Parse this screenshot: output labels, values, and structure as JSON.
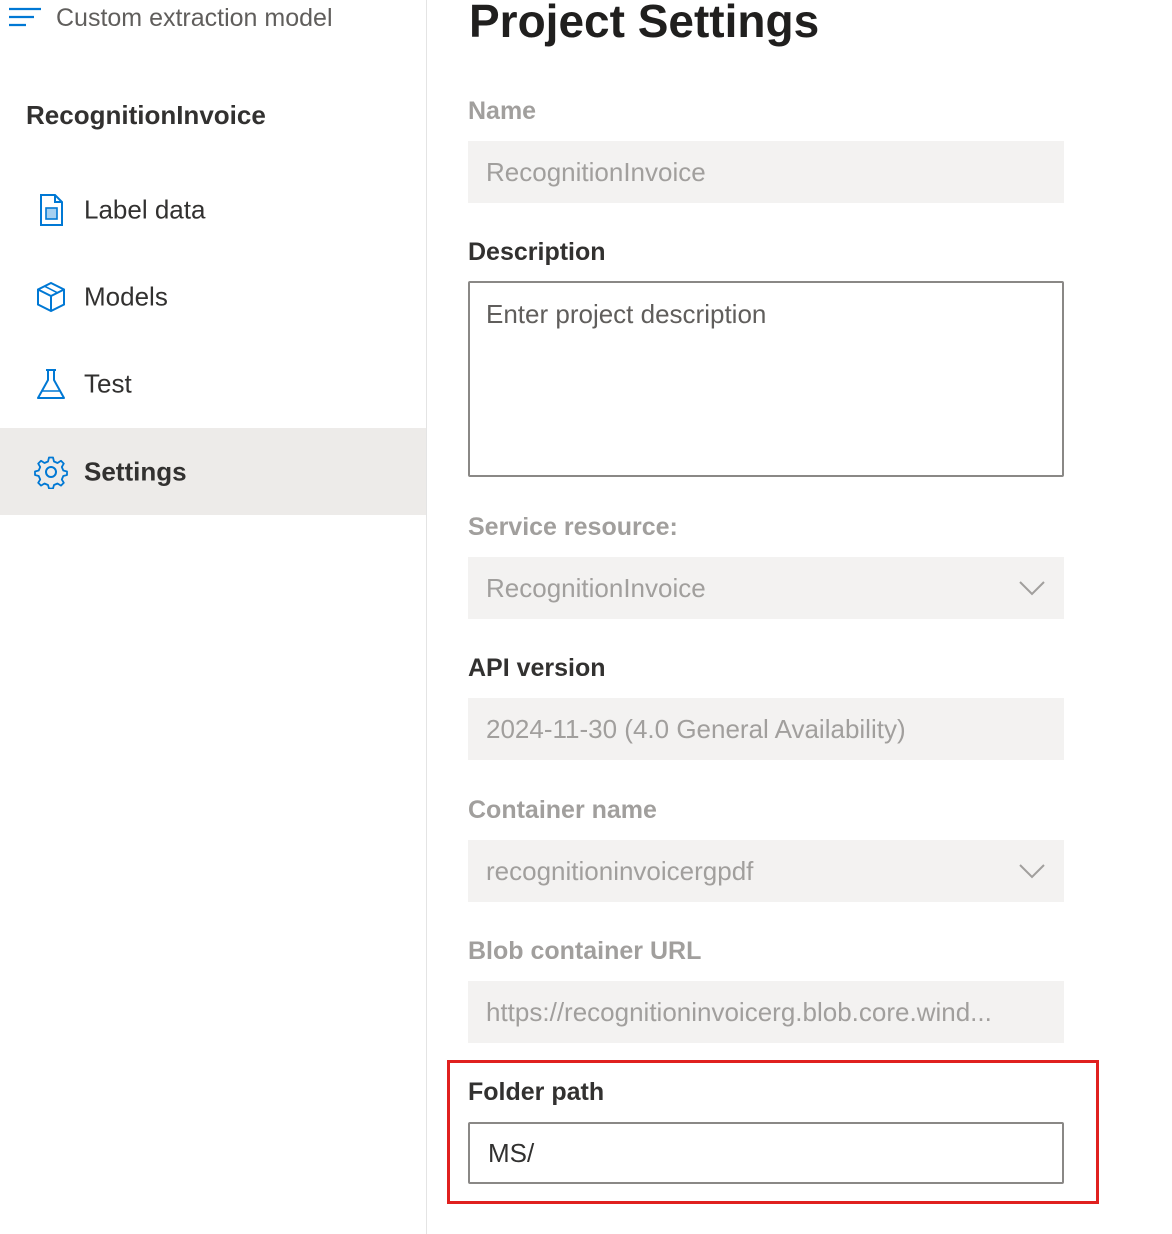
{
  "sidebar": {
    "app_title": "Custom extraction model",
    "project_name": "RecognitionInvoice",
    "items": [
      {
        "label": "Label data",
        "icon": "document-icon"
      },
      {
        "label": "Models",
        "icon": "cube-icon"
      },
      {
        "label": "Test",
        "icon": "flask-icon"
      },
      {
        "label": "Settings",
        "icon": "gear-icon",
        "selected": true
      }
    ]
  },
  "main": {
    "title": "Project Settings",
    "fields": {
      "name": {
        "label": "Name",
        "value": "RecognitionInvoice"
      },
      "description": {
        "label": "Description",
        "placeholder": "Enter project description"
      },
      "service_resource": {
        "label": "Service resource:",
        "value": "RecognitionInvoice"
      },
      "api_version": {
        "label": "API version",
        "value": "2024-11-30 (4.0 General Availability)"
      },
      "container_name": {
        "label": "Container name",
        "value": "recognitioninvoicergpdf"
      },
      "blob_url": {
        "label": "Blob container URL",
        "value": "https://recognitioninvoicerg.blob.core.wind..."
      },
      "folder_path": {
        "label": "Folder path",
        "value": "MS/"
      }
    }
  },
  "colors": {
    "accent": "#0078d4",
    "highlight": "#e0201f",
    "selected_bg": "#edebe9",
    "disabled_field_bg": "#f3f2f1"
  }
}
